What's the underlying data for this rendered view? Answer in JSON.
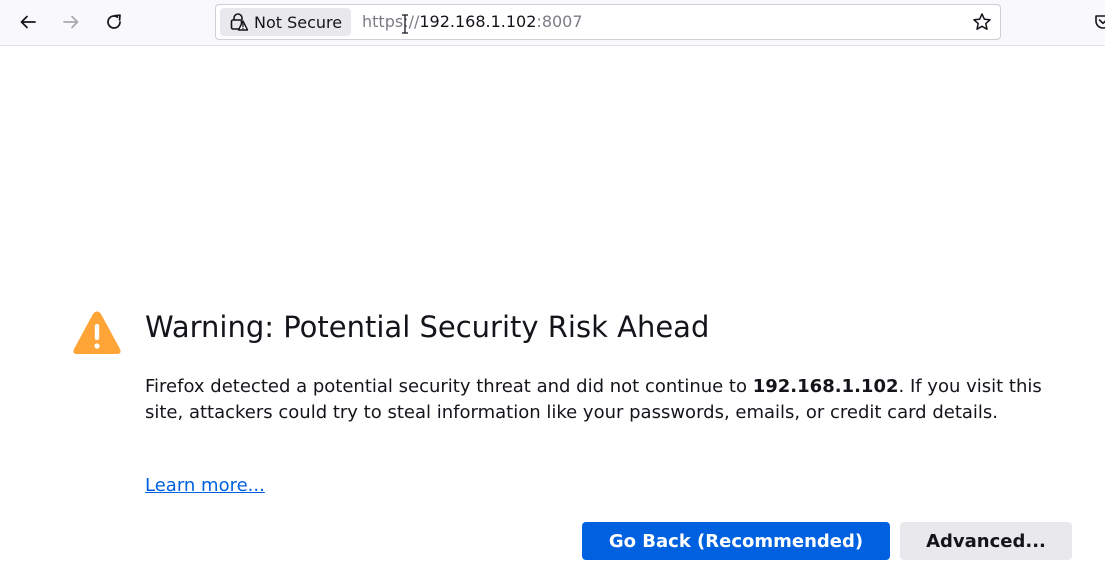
{
  "browser": {
    "nav": {
      "back_icon": "arrow-left-icon",
      "forward_icon": "arrow-right-icon",
      "reload_icon": "reload-icon"
    },
    "urlbar": {
      "identity_label": "Not Secure",
      "identity_icon": "lock-warning-icon",
      "url_scheme": "https://",
      "url_host": "192.168.1.102",
      "url_port": ":8007",
      "bookmark_icon": "star-icon"
    },
    "pocket_icon": "pocket-icon"
  },
  "error_page": {
    "icon": "warning-triangle-icon",
    "icon_color": "#ffa436",
    "title": "Warning: Potential Security Risk Ahead",
    "description_before": "Firefox detected a potential security threat and did not continue to ",
    "description_host": "192.168.1.102",
    "description_after": ". If you visit this site, attackers could try to steal information like your passwords, emails, or credit card details.",
    "learn_more": "Learn more...",
    "go_back_button": "Go Back (Recommended)",
    "advanced_button": "Advanced..."
  },
  "colors": {
    "accent": "#0061e0",
    "secondary_button": "#e9e9ed",
    "warning": "#ffa436"
  }
}
